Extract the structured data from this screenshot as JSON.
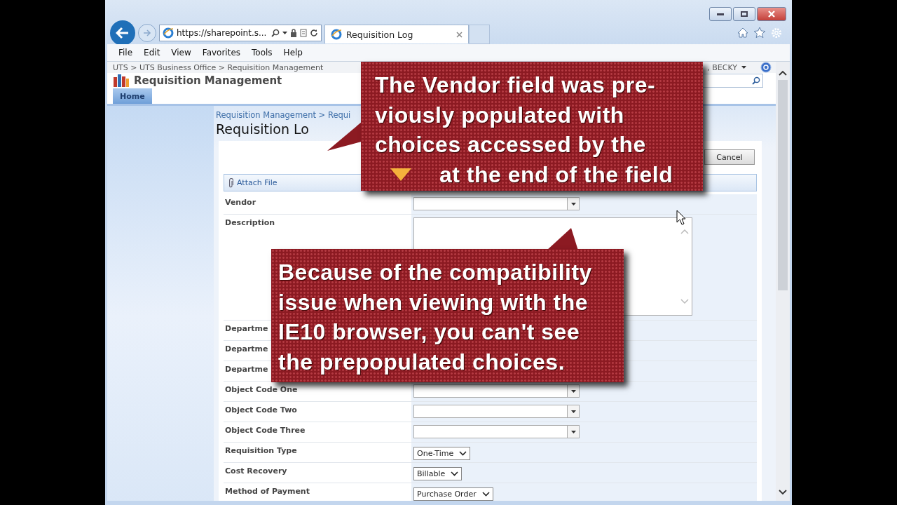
{
  "browser": {
    "address": "https://sharepoint.s...",
    "tab": {
      "title": "Requisition Log",
      "selected": true
    },
    "menu": [
      "File",
      "Edit",
      "View",
      "Favorites",
      "Tools",
      "Help"
    ]
  },
  "site": {
    "breadcrumb": "UTS > UTS Business Office > Requisition Management",
    "user": ", BECKY",
    "title": "Requisition Management",
    "nav_tabs": [
      {
        "label": "Home",
        "selected": true
      }
    ]
  },
  "page": {
    "breadcrumb": "Requisition Management > Requi",
    "title": "Requisition Lo",
    "cancel": "Cancel",
    "attach": "Attach File",
    "rows": [
      {
        "label": "Vendor",
        "kind": "combo"
      },
      {
        "label": "Description",
        "kind": "textarea"
      },
      {
        "label": "Departme",
        "kind": "none"
      },
      {
        "label": "Departme",
        "kind": "none"
      },
      {
        "label": "Departme",
        "kind": "none"
      },
      {
        "label": "Object Code One",
        "kind": "combo"
      },
      {
        "label": "Object Code Two",
        "kind": "combo"
      },
      {
        "label": "Object Code Three",
        "kind": "combo"
      },
      {
        "label": "Requisition Type",
        "kind": "select",
        "value": "One-Time"
      },
      {
        "label": "Cost Recovery",
        "kind": "select",
        "value": "Billable"
      },
      {
        "label": "Method of Payment",
        "kind": "select",
        "value": "Purchase Order"
      }
    ]
  },
  "callouts": [
    {
      "lines": [
        "The Vendor field was pre-",
        "viously populated with",
        "choices accessed by the"
      ],
      "after_icon": "at the end of the field"
    },
    {
      "lines": [
        "Because of the compatibility",
        "issue when viewing with the",
        "IE10 browser, you can't see",
        "the prepopulated choices."
      ]
    }
  ]
}
